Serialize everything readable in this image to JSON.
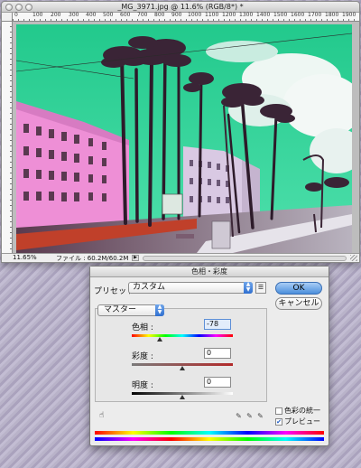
{
  "document_window": {
    "title": "_MG_3971.jpg @ 11.6% (RGB/8*) *",
    "ruler_ticks": [
      "0",
      "100",
      "200",
      "300",
      "400",
      "500",
      "600",
      "700",
      "800",
      "900",
      "1000",
      "1100",
      "1200",
      "1300",
      "1400",
      "1500",
      "1600",
      "1700",
      "1800",
      "1900"
    ],
    "status": {
      "zoom": "11.65%",
      "file_size": "ファイル : 60.2M/60.2M"
    },
    "icons": [
      "close-button",
      "minimize-button",
      "zoom-button",
      "status-menu-arrow",
      "resize-grip"
    ]
  },
  "dialog": {
    "title": "色相・彩度",
    "preset_label": "プリセット :",
    "preset_value": "カスタム",
    "ok_label": "OK",
    "cancel_label": "キャンセル",
    "channel_value": "マスター",
    "hue": {
      "label": "色相 :",
      "value": "-78",
      "slider_fraction": 0.28
    },
    "saturation": {
      "label": "彩度 :",
      "value": "0",
      "slider_fraction": 0.5
    },
    "lightness": {
      "label": "明度 :",
      "value": "0",
      "slider_fraction": 0.5
    },
    "colorize_label": "色彩の統一",
    "colorize_checked": false,
    "preview_label": "プレビュー",
    "preview_checked": true,
    "icons": [
      "hand-adjust-icon",
      "eyedropper-icon",
      "eyedropper-plus-icon",
      "eyedropper-minus-icon",
      "preset-menu-icon"
    ]
  },
  "colors": {
    "sky": "#2fd59a",
    "building": "#ee8fd6",
    "ok_button": "#4b8fdc"
  }
}
